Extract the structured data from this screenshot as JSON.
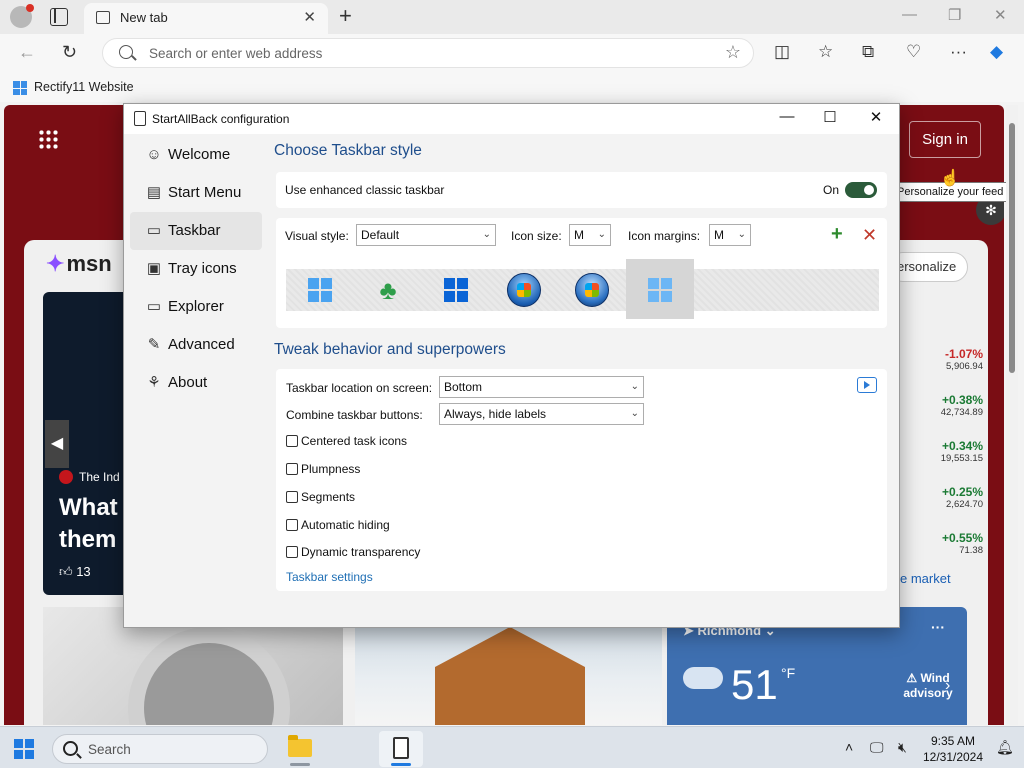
{
  "browser": {
    "tab_title": "New tab",
    "address_placeholder": "Search or enter web address",
    "favorites": [
      {
        "label": "Rectify11 Website"
      }
    ]
  },
  "msn": {
    "signin_label": "Sign in",
    "logo_text": "msn",
    "personalize_label": "ersonalize",
    "tooltip": "Personalize your feed",
    "hero": {
      "source": "The Ind",
      "headline": "What them",
      "likes": "13"
    },
    "markets": [
      {
        "pct": "-1.07%",
        "val": "5,906.94",
        "color": "#c62828"
      },
      {
        "pct": "+0.38%",
        "val": "42,734.89",
        "color": "#1b7a34"
      },
      {
        "pct": "+0.34%",
        "val": "19,553.15",
        "color": "#1b7a34"
      },
      {
        "pct": "+0.25%",
        "val": "2,624.70",
        "color": "#1b7a34"
      },
      {
        "pct": "+0.55%",
        "val": "71.38",
        "color": "#1b7a34"
      }
    ],
    "see_market": "e market",
    "weather": {
      "city": "Richmond",
      "temp": "51",
      "unit": "°F",
      "alert": "Wind advisory",
      "more": "···"
    }
  },
  "dialog": {
    "title": "StartAllBack configuration",
    "nav": [
      {
        "label": "Welcome",
        "icon": "smile-icon",
        "glyph": "☺"
      },
      {
        "label": "Start Menu",
        "icon": "start-menu-icon",
        "glyph": "▤"
      },
      {
        "label": "Taskbar",
        "icon": "taskbar-icon",
        "glyph": "▭"
      },
      {
        "label": "Tray icons",
        "icon": "tray-icon",
        "glyph": "▣"
      },
      {
        "label": "Explorer",
        "icon": "folder-icon",
        "glyph": "🗀"
      },
      {
        "label": "Advanced",
        "icon": "wrench-icon",
        "glyph": "🔧"
      },
      {
        "label": "About",
        "icon": "about-icon",
        "glyph": "⚘"
      }
    ],
    "active_nav": "Taskbar",
    "choose_title": "Choose Taskbar style",
    "enhanced_label": "Use enhanced classic taskbar",
    "enhanced_state": "On",
    "visual_style_label": "Visual style:",
    "visual_style_value": "Default",
    "icon_size_label": "Icon size:",
    "icon_size_value": "M",
    "icon_margins_label": "Icon margins:",
    "icon_margins_value": "M",
    "styles": [
      "windows-10-style",
      "clover-style",
      "windows-11-blue-style",
      "windows-7-orb-style",
      "windows-vista-orb-style",
      "windows-11-style"
    ],
    "selected_style": 5,
    "tweak_title": "Tweak behavior and superpowers",
    "location_label": "Taskbar location on screen:",
    "location_value": "Bottom",
    "combine_label": "Combine taskbar buttons:",
    "combine_value": "Always, hide labels",
    "checkboxes": [
      {
        "label": "Centered task icons",
        "checked": false
      },
      {
        "label": "Plumpness",
        "checked": false
      },
      {
        "label": "Segments",
        "checked": false
      },
      {
        "label": "Automatic hiding",
        "checked": false
      },
      {
        "label": "Dynamic transparency",
        "checked": false
      }
    ],
    "settings_link": "Taskbar settings"
  },
  "taskbar": {
    "search_placeholder": "Search",
    "time": "9:35 AM",
    "date": "12/31/2024"
  }
}
